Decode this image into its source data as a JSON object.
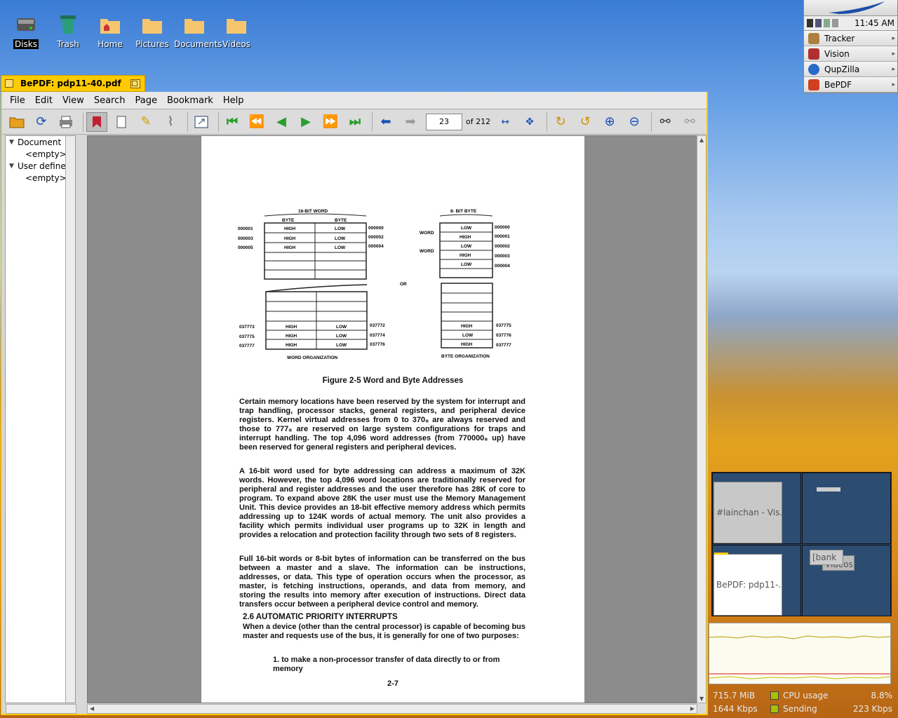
{
  "desktop": {
    "icons": [
      {
        "label": "Disks"
      },
      {
        "label": "Trash"
      },
      {
        "label": "Home"
      },
      {
        "label": "Pictures"
      },
      {
        "label": "Documents"
      },
      {
        "label": "Videos"
      }
    ]
  },
  "deskbar": {
    "clock": "11:45 AM",
    "apps": [
      "Tracker",
      "Vision",
      "QupZilla",
      "BePDF"
    ]
  },
  "window": {
    "title": "BePDF: pdp11-40.pdf",
    "menu": [
      "File",
      "Edit",
      "View",
      "Search",
      "Page",
      "Bookmark",
      "Help"
    ],
    "page_current": "23",
    "page_total_label": "of 212",
    "outline": [
      {
        "label": "Document",
        "child": "<empty>"
      },
      {
        "label": "User defined",
        "child": "<empty>"
      }
    ]
  },
  "document": {
    "figure": {
      "word_title": "16-BIT  WORD",
      "byte_title": "8- BIT BYTE",
      "byte_label": "BYTE",
      "word_label": "WORD",
      "high": "HIGH",
      "low": "LOW",
      "or": "OR",
      "word_org": "WORD ORGANIZATION",
      "byte_org": "BYTE  ORGANIZATION",
      "left_addrs_top": [
        "000001",
        "000003",
        "000005"
      ],
      "right_addrs_top": [
        "000000",
        "000002",
        "000004"
      ],
      "left_addrs_bottom": [
        "037773",
        "037775",
        "037777"
      ],
      "right_addrs_bottom": [
        "037772",
        "037774",
        "037776"
      ],
      "byte_addrs_top": [
        "000000",
        "000001",
        "000002",
        "000003",
        "000004"
      ],
      "byte_addrs_bottom": [
        "037775",
        "037776",
        "037777"
      ]
    },
    "caption": "Figure 2-5 Word  and Byte Addresses",
    "paragraphs": [
      "Certain memory locations have been reserved by the system for interrupt and trap handling, processor stacks, general registers, and peripheral device registers. Kernel virtual addresses from 0 to 370₈ are always reserved and those to 777₈ are reserved on large system configurations for traps and interrupt handling. The top 4,096 word addresses (from 770000₈ up) have been reserved for general registers and peripheral devices.",
      "A 16-bit word used for byte addressing can address a maximum of 32K words. However, the top 4,096 word locations are traditionally reserved for peripheral and register addresses and the user therefore has 28K of core to program. To expand above 28K the user must use the Memory Management Unit. This device provides an 18-bit effective memory address which permits addressing up to 124K words of actual memory. The unit also provides a facility which permits individual user programs up to 32K in length and provides a relocation and protection facility through two sets of 8 registers.",
      "Full 16-bit words or 8-bit bytes of information can be transferred on the bus between a master and a slave. The information can be instructions, addresses, or data. This type of operation occurs when the processor, as master, is fetching instructions, operands, and data from memory, and storing the results into memory after execution of instructions. Direct data transfers occur between a peripheral device control and memory."
    ],
    "heading": "2.6 AUTOMATIC PRIORITY INTERRUPTS",
    "heading_para": "When a device (other than the central processor) is capable of becoming bus master and requests use of the bus, it is generally for one of two purposes:",
    "list_item": "1.  to make a non-processor transfer of data directly to or from memory",
    "page_number": "2-7"
  },
  "workspaces": {
    "ws1_window": "#lainchan - Vis...",
    "ws3_window": "BePDF: pdp11-...",
    "ws4_window_a": "[bank",
    "ws4_window_b": "Videos"
  },
  "activity": {
    "memory": "715.7 MiB",
    "cpu_label": "CPU usage",
    "cpu_value": "8.8%",
    "receive": "1644 Kbps",
    "send_label": "Sending",
    "send_value": "223 Kbps"
  }
}
